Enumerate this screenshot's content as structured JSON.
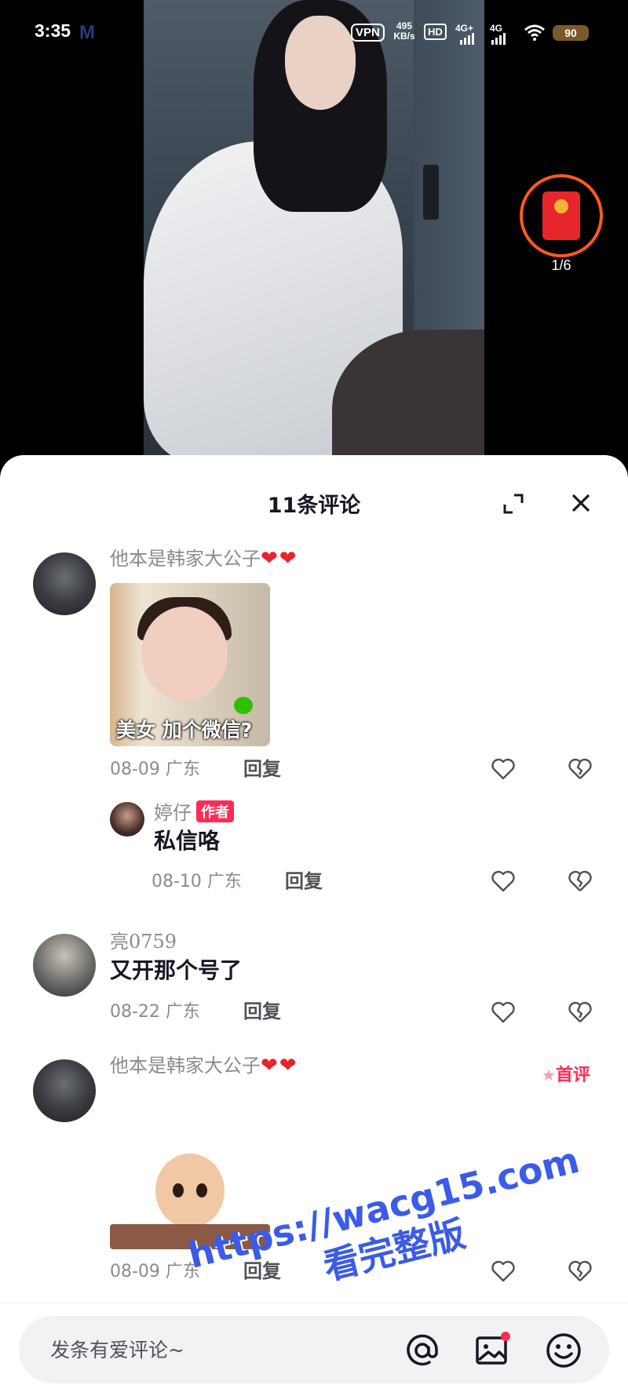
{
  "status_bar": {
    "time": "3:35",
    "vpn": "VPN",
    "speed_value": "495",
    "speed_unit": "KB/s",
    "hd": "HD",
    "net1": "4G+",
    "net2": "4G",
    "battery": "90"
  },
  "red_packet": {
    "count": "1/6"
  },
  "comments_panel": {
    "title": "11条评论",
    "comments": [
      {
        "user": "他本是韩家大公子",
        "hearts": "❤❤",
        "sticker_caption": "美女 加个微信?",
        "date_location": "08-09 广东",
        "reply_label": "回复",
        "replies": [
          {
            "user": "婷仔",
            "badge": "作者",
            "text": "私信咯",
            "date_location": "08-10 广东",
            "reply_label": "回复"
          }
        ]
      },
      {
        "user": "亮0759",
        "text": "又开那个号了",
        "date_location": "08-22 广东",
        "reply_label": "回复"
      },
      {
        "user": "他本是韩家大公子",
        "hearts": "❤❤",
        "badge": "首评",
        "date_location": "08-09 广东",
        "reply_label": "回复"
      }
    ]
  },
  "input": {
    "placeholder": "发条有爱评论~"
  },
  "watermark": {
    "line1": "https://wacg15.com",
    "line2": "看完整版"
  },
  "colors": {
    "accent": "#fe2c55",
    "heart": "#e8242c",
    "watermark": "#3b5be8",
    "red_packet_ring": "#ff5a1f"
  }
}
